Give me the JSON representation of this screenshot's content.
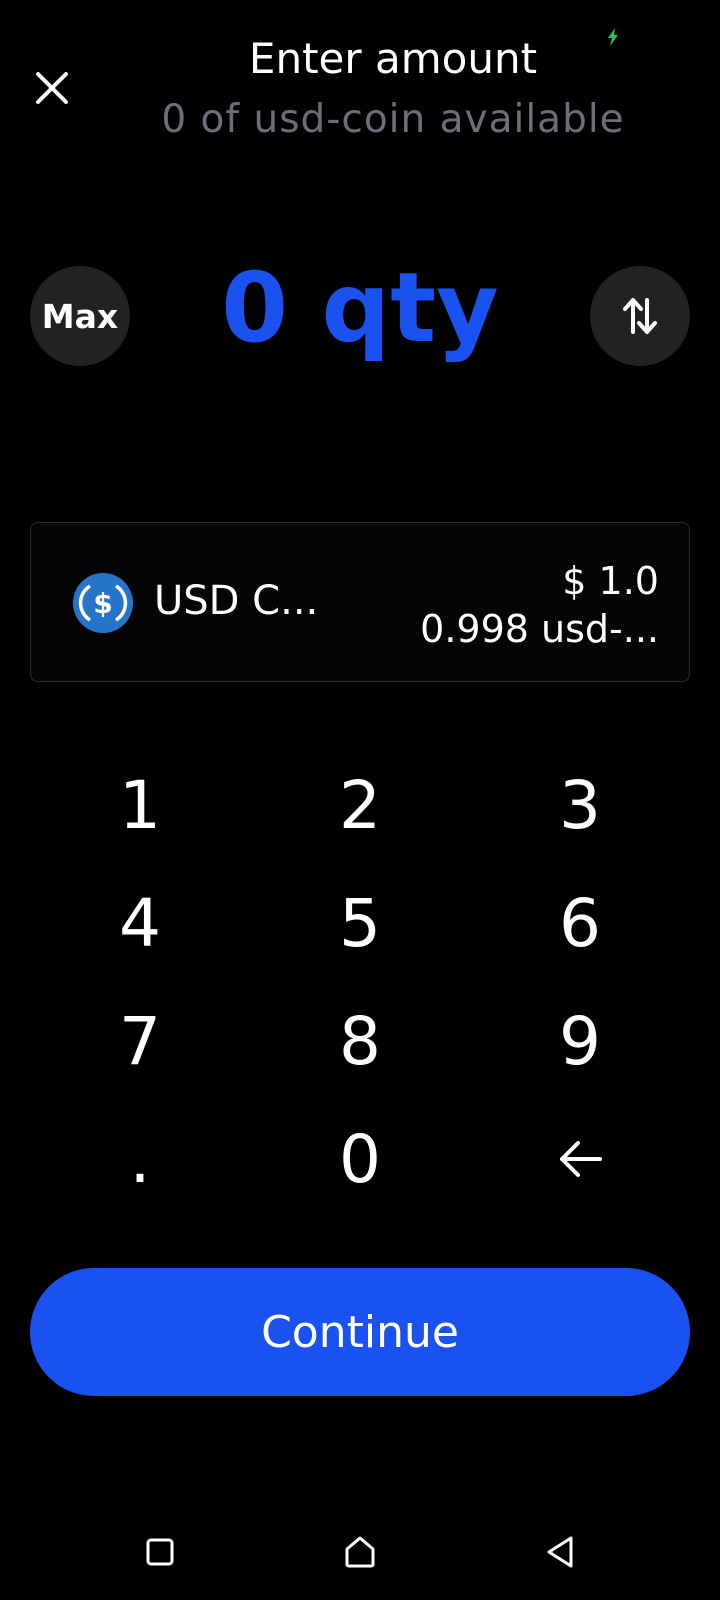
{
  "header": {
    "title": "Enter amount",
    "subtitle": "0 of usd-coin available",
    "close_icon": "close-icon"
  },
  "amount": {
    "max_label": "Max",
    "value": "0 qty",
    "swap_icon": "swap-vertical-icon"
  },
  "asset": {
    "icon": "usd-coin-icon",
    "name": "USD C...",
    "price": "$ 1.0",
    "quantity": "0.998 usd-..."
  },
  "keypad": {
    "keys": [
      "1",
      "2",
      "3",
      "4",
      "5",
      "6",
      "7",
      "8",
      "9",
      ".",
      "0"
    ],
    "backspace_icon": "backspace-arrow-icon"
  },
  "continue_label": "Continue",
  "colors": {
    "accent": "#1a52f0",
    "background": "#000000",
    "muted_text": "#6b6f78",
    "button_dark": "#222222",
    "coin_blue": "#2775ca",
    "charging": "#21c55d"
  },
  "system_nav": [
    "recents-square-icon",
    "home-icon",
    "back-triangle-icon"
  ]
}
